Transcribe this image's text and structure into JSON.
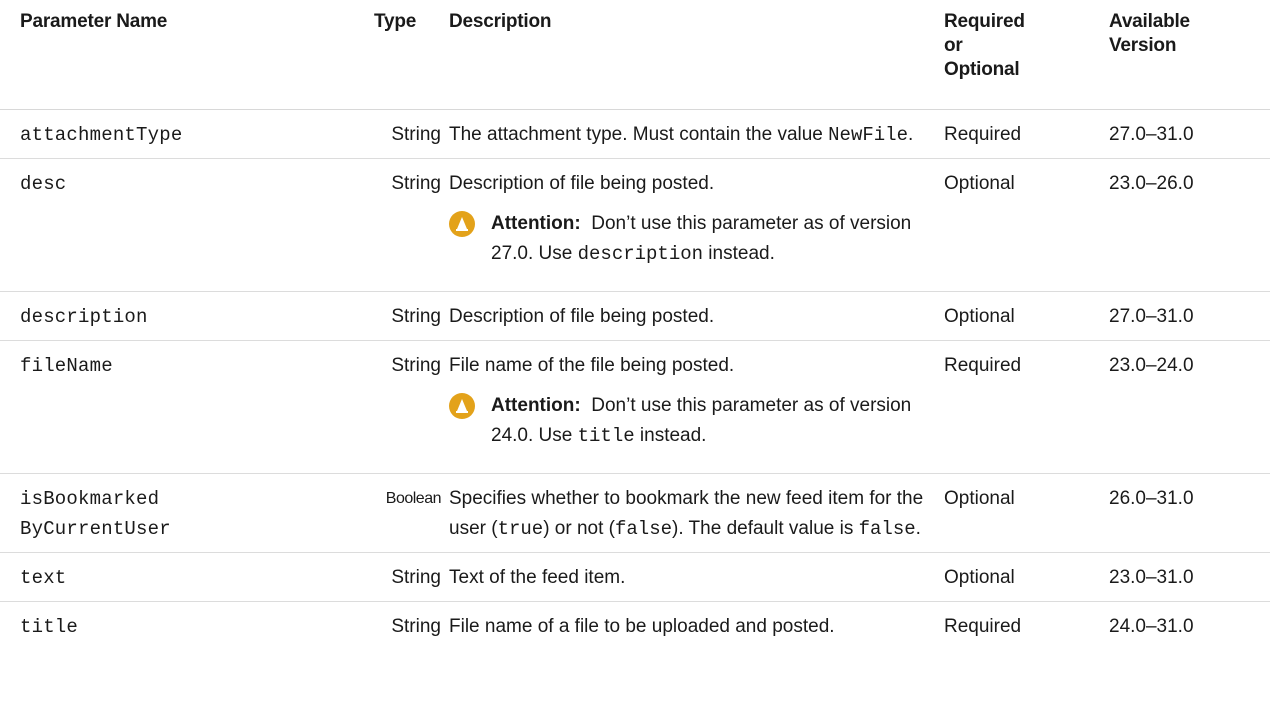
{
  "headers": {
    "param": "Parameter Name",
    "type": "Type",
    "desc": "Description",
    "req_line1": "Required",
    "req_line2": "or",
    "req_line3": "Optional",
    "ver_line1": "Available",
    "ver_line2": "Version"
  },
  "rows": [
    {
      "name": "attachmentType",
      "type": "String",
      "desc_pre": "The attachment type. Must contain the value ",
      "desc_code": "NewFile",
      "desc_post": ".",
      "req": "Required",
      "ver": "27.0–31.0"
    },
    {
      "name": "desc",
      "type": "String",
      "desc": "Description of file being posted.",
      "attn_label": "Attention:",
      "attn_pre": "Don’t use this parameter as of version 27.0. Use ",
      "attn_code": "description",
      "attn_post": " instead.",
      "req": "Optional",
      "ver": "23.0–26.0"
    },
    {
      "name": "description",
      "type": "String",
      "desc": "Description of file being posted.",
      "req": "Optional",
      "ver": "27.0–31.0"
    },
    {
      "name": "fileName",
      "type": "String",
      "desc": "File name of the file being posted.",
      "attn_label": "Attention:",
      "attn_pre": "Don’t use this parameter as of version 24.0. Use ",
      "attn_code": "title",
      "attn_post": " instead.",
      "req": "Required",
      "ver": "23.0–24.0"
    },
    {
      "name_line1": "isBookmarked",
      "name_line2": "ByCurrentUser",
      "type": "Boolean",
      "desc_a": "Specifies whether to bookmark the new feed item for the user (",
      "desc_code1": "true",
      "desc_b": ") or not (",
      "desc_code2": "false",
      "desc_c": "). The default value is ",
      "desc_code3": "false",
      "desc_d": ".",
      "req": "Optional",
      "ver": "26.0–31.0"
    },
    {
      "name": "text",
      "type": "String",
      "desc": "Text of the feed item.",
      "req": "Optional",
      "ver": "23.0–31.0"
    },
    {
      "name": "title",
      "type": "String",
      "desc": "File name of a file to be uploaded and posted.",
      "req": "Required",
      "ver": "24.0–31.0"
    }
  ],
  "icons": {
    "attention": "attention-icon",
    "attention_color": "#e3a21a"
  }
}
